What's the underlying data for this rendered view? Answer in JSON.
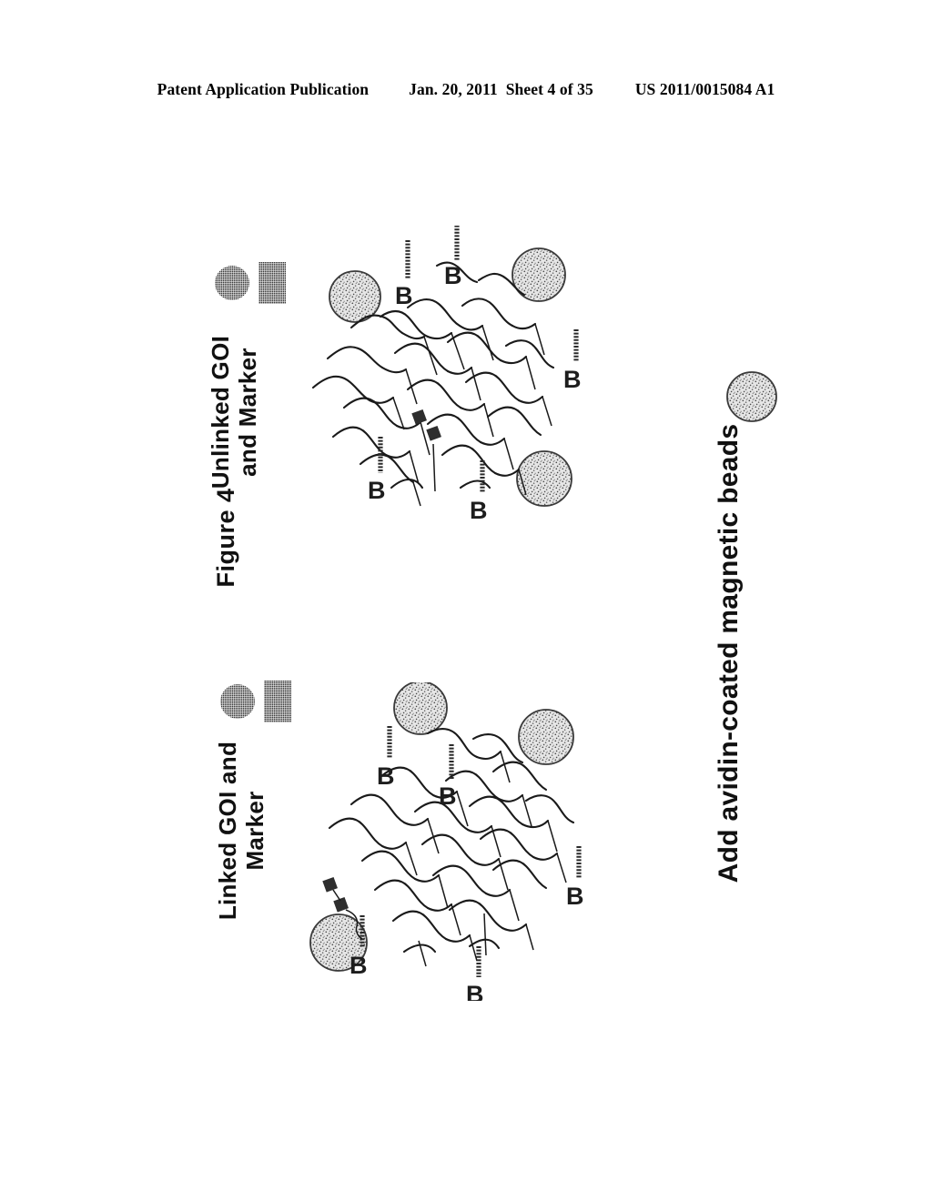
{
  "header": {
    "publication": "Patent Application Publication",
    "date": "Jan. 20, 2011",
    "sheet": "Sheet 4 of 35",
    "patent_number": "US 2011/0015084 A1"
  },
  "figure": {
    "label": "Figure 4",
    "caption_bottom": "Add avidin-coated magnetic beads"
  },
  "panels": [
    {
      "id": "linked",
      "title": "Linked GOI and\nMarker",
      "legend": {
        "circle_label": "GOI",
        "square_label": "Marker",
        "circle_color": "#3a3a3a",
        "square_color": "#3a3a3a"
      },
      "biotin_tags": [
        "B",
        "B",
        "B",
        "B",
        "B"
      ],
      "bead_count": 3,
      "strand_count": 22
    },
    {
      "id": "unlinked",
      "title": "Unlinked GOI\nand Marker",
      "legend": {
        "circle_label": "GOI",
        "square_label": "Marker",
        "circle_color": "#3a3a3a",
        "square_color": "#3a3a3a"
      },
      "biotin_tags": [
        "B",
        "B",
        "B",
        "B",
        "B"
      ],
      "bead_count": 3,
      "strand_count": 22
    }
  ],
  "standalone_bead": {
    "name": "avidin-coated magnetic bead",
    "color": "#d8d8d8"
  },
  "symbols": {
    "biotin": "B",
    "bead_fill": "#dcdcdc",
    "bead_stroke": "#333333",
    "strand_stroke": "#1a1a1a"
  }
}
